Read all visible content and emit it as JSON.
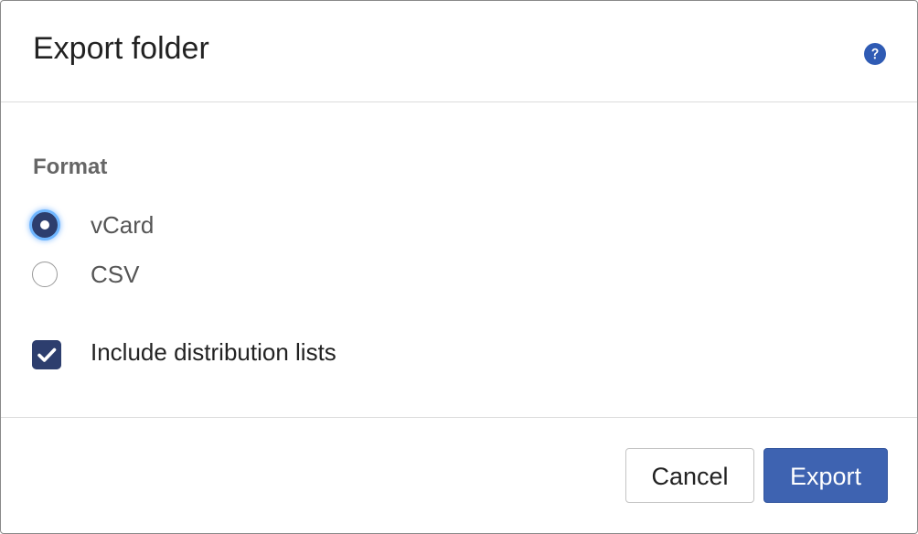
{
  "dialog": {
    "title": "Export folder",
    "help_icon": "question-circle-icon"
  },
  "format": {
    "label": "Format",
    "options": [
      {
        "label": "vCard",
        "selected": true
      },
      {
        "label": "CSV",
        "selected": false
      }
    ]
  },
  "include_distribution_lists": {
    "label": "Include distribution lists",
    "checked": true
  },
  "footer": {
    "cancel_label": "Cancel",
    "export_label": "Export"
  },
  "colors": {
    "primary": "#3e63b1",
    "checked_control": "#2d3e6e",
    "focus_ring": "#6fb6ff"
  }
}
